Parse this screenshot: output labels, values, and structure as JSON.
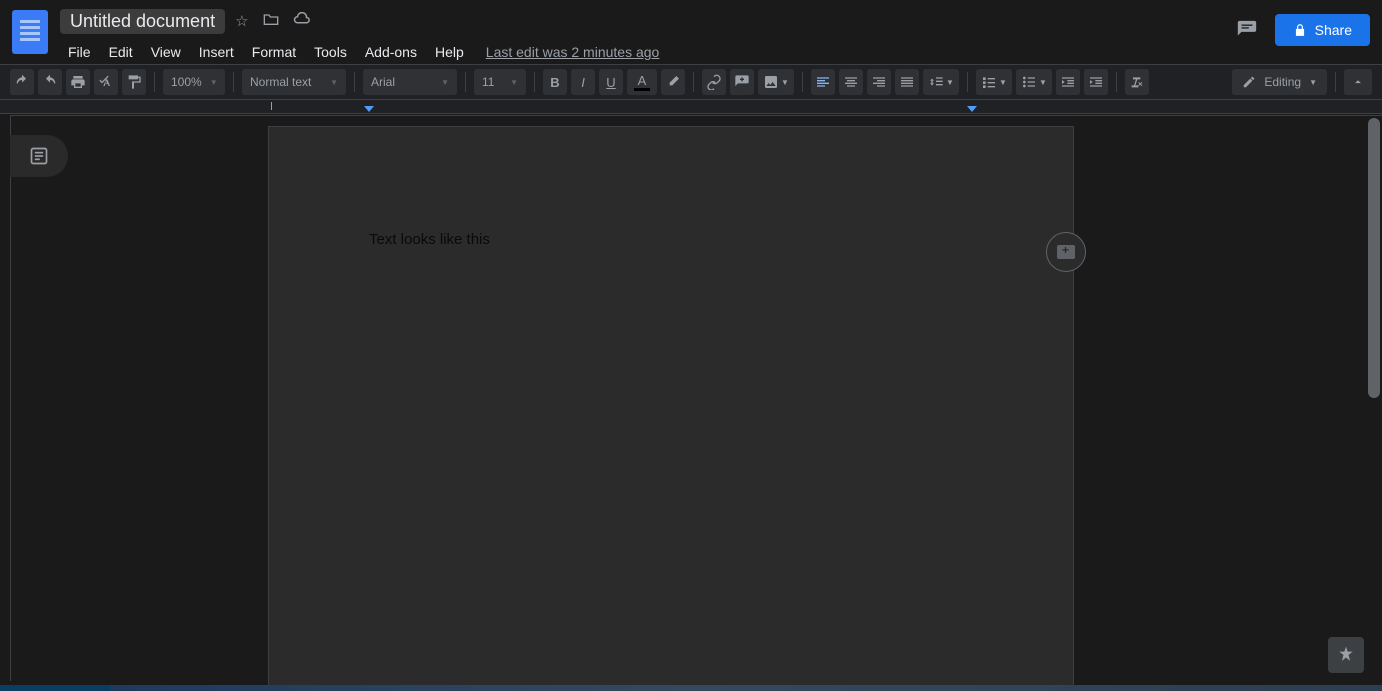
{
  "header": {
    "title": "Untitled document",
    "last_edit": "Last edit was 2 minutes ago",
    "share_label": "Share"
  },
  "menu": {
    "file": "File",
    "edit": "Edit",
    "view": "View",
    "insert": "Insert",
    "format": "Format",
    "tools": "Tools",
    "addons": "Add-ons",
    "help": "Help"
  },
  "toolbar": {
    "zoom": "100%",
    "style": "Normal text",
    "font": "Arial",
    "font_size": "11",
    "mode": "Editing",
    "text_color": "#000000",
    "highlight_color": "transparent"
  },
  "document": {
    "body_text": "Text looks like this"
  }
}
